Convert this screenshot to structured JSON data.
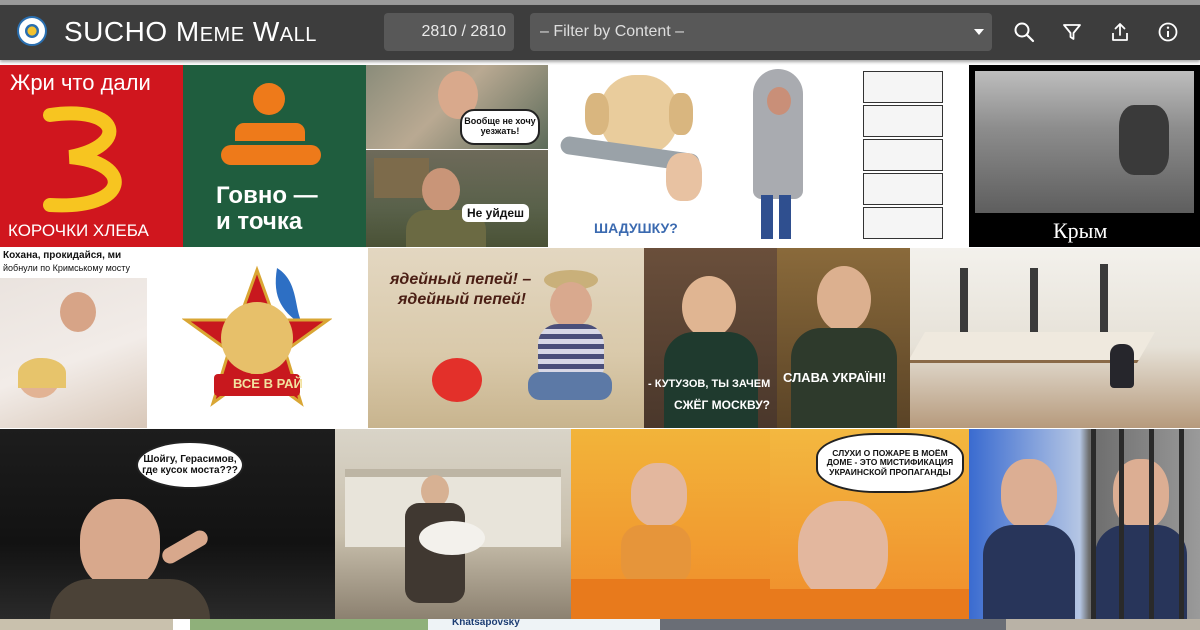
{
  "header": {
    "title": "SUCHO Meme Wall",
    "counter": "2810 / 2810",
    "filter_placeholder": "– Filter by Content –"
  },
  "toolbar_icons": [
    "search-icon",
    "filter-icon",
    "share-icon",
    "info-icon"
  ],
  "colors": {
    "header_bg": "#3d3d3d",
    "control_bg": "#585858",
    "text": "#ffffff"
  },
  "memes": [
    {
      "id": "korochki",
      "texts": [
        "Жри что дали",
        "КОРОЧКИ ХЛЕБА"
      ]
    },
    {
      "id": "govno",
      "texts": [
        "Говно —",
        "и точка"
      ]
    },
    {
      "id": "uezhat",
      "texts": [
        "Вообще не хочу уезжать!"
      ]
    },
    {
      "id": "ne-uidesh",
      "texts": [
        "Не уйдеш"
      ]
    },
    {
      "id": "shadushku",
      "texts": [
        "ШАДУШКУ?"
      ]
    },
    {
      "id": "krym",
      "texts": [
        "Крым"
      ]
    },
    {
      "id": "kokhana",
      "texts": [
        "Кохана, прокидайся, ми",
        "йобнули по Кримському мосту"
      ]
    },
    {
      "id": "pioneer",
      "texts": [
        "ВСЕ В РАЙ"
      ]
    },
    {
      "id": "pepel",
      "texts": [
        "ядейный пепей! –",
        "ядейный пепей!"
      ]
    },
    {
      "id": "kutuzov",
      "texts": [
        "- КУТУЗОВ, ТЫ ЗАЧЕМ",
        "СЖЁГ МОСКВУ?",
        "СЛАВА УКРАЇНІ!"
      ]
    },
    {
      "id": "longtable",
      "texts": []
    },
    {
      "id": "prigozhin",
      "texts": [
        "Шойгу, Герасимов, где кусок моста???"
      ]
    },
    {
      "id": "goose",
      "texts": []
    },
    {
      "id": "thisisfine",
      "texts": [
        "СЛУХИ О ПОЖАРЕ В МОЁМ ДОМЕ - ЭТО МИСТИФИКАЦИЯ УКРАИНСКОЙ ПРОПАГАНДЫ"
      ]
    },
    {
      "id": "surovikin",
      "texts": []
    },
    {
      "id": "khatsapovsky",
      "texts": [
        "Khatsapovsky"
      ]
    }
  ]
}
